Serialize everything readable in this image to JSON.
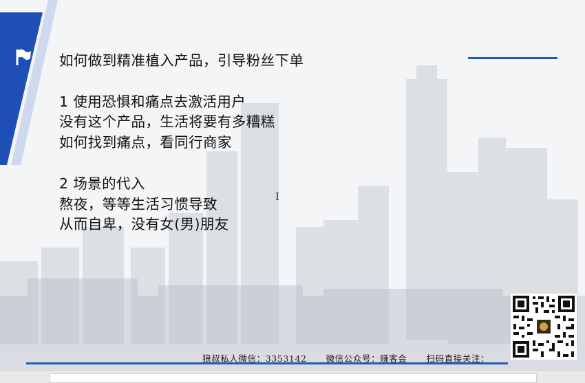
{
  "slide": {
    "title": "如何做到精准植入产品，引导粉丝下单",
    "lines": [
      "1 使用恐惧和痛点去激活用户",
      "没有这个产品，生活将要有多糟糕",
      "如何找到痛点，看同行商家",
      "2 场景的代入",
      "熬夜，等等生活习惯导致",
      "从而自卑，没有女(男)朋友"
    ],
    "footer": {
      "wechat": "狼叔私人微信：3353142",
      "official": "微信公众号：赚客会",
      "scan": "扫码直接关注："
    }
  },
  "cursor_glyph": "I",
  "colors": {
    "accent": "#2458b7",
    "background": "#f4f5f7"
  },
  "icons": [
    "flag-icon",
    "text-cursor-icon",
    "qr-code"
  ]
}
